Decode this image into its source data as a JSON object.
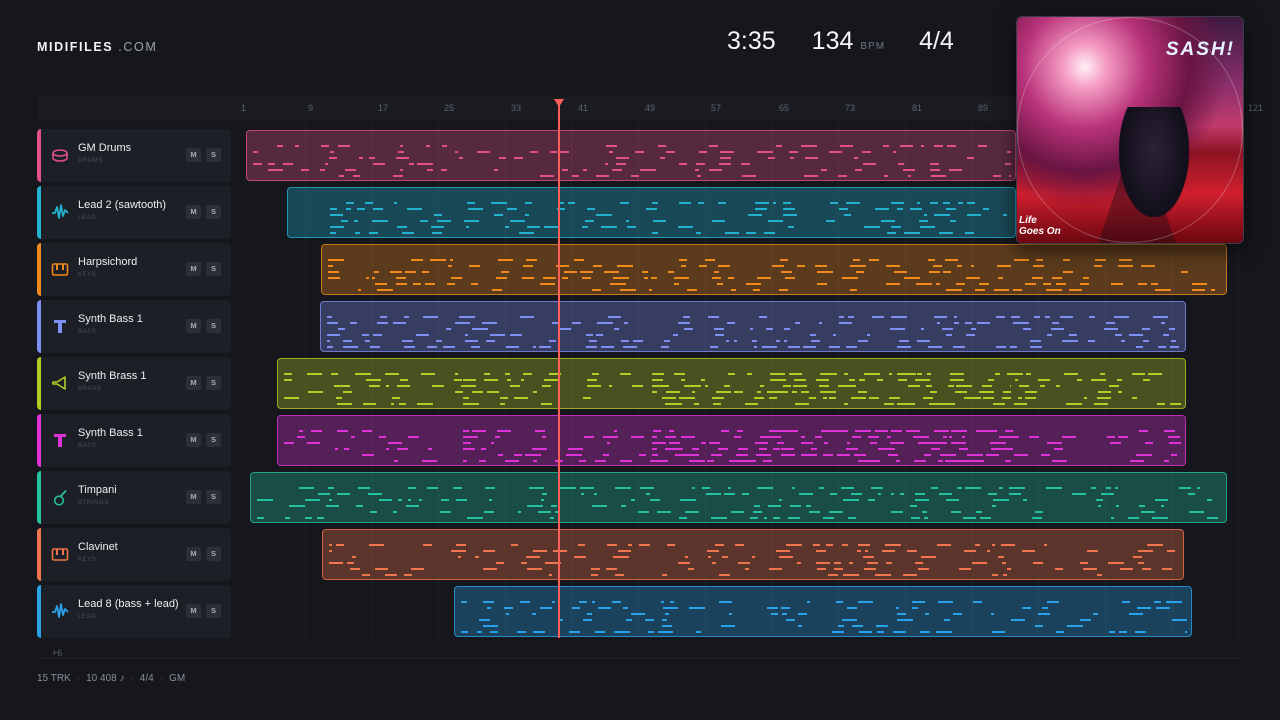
{
  "header": {
    "brand_main": "MIDIFILES",
    "brand_suffix": ".COM",
    "duration": "3:35",
    "tempo": "134",
    "tempo_unit": "BPM",
    "time_signature": "4/4"
  },
  "ruler": {
    "marks": [
      "1",
      "9",
      "17",
      "25",
      "33",
      "41",
      "49",
      "57",
      "65",
      "73",
      "81",
      "89",
      "121"
    ]
  },
  "tracks": [
    {
      "name": "GM Drums",
      "category": "DRUMS",
      "color": "#e2508a",
      "icon": "drum-icon",
      "mute": "M",
      "solo": "S"
    },
    {
      "name": "Lead 2 (sawtooth)",
      "category": "LEAD",
      "color": "#22b2cf",
      "icon": "wave-icon",
      "mute": "M",
      "solo": "S"
    },
    {
      "name": "Harpsichord",
      "category": "KEYS",
      "color": "#f08a1c",
      "icon": "keys-icon",
      "mute": "M",
      "solo": "S"
    },
    {
      "name": "Synth Bass 1",
      "category": "BASS",
      "color": "#7d8ff2",
      "icon": "bass-icon",
      "mute": "M",
      "solo": "S"
    },
    {
      "name": "Synth Brass 1",
      "category": "BRASS",
      "color": "#b4cc24",
      "icon": "horn-icon",
      "mute": "M",
      "solo": "S"
    },
    {
      "name": "Synth Bass 1",
      "category": "BASS",
      "color": "#dd33d8",
      "icon": "bass-icon",
      "mute": "M",
      "solo": "S"
    },
    {
      "name": "Timpani",
      "category": "STRINGS",
      "color": "#25c0a0",
      "icon": "guitar-icon",
      "mute": "M",
      "solo": "S"
    },
    {
      "name": "Clavinet",
      "category": "KEYS",
      "color": "#f0744c",
      "icon": "keys-icon",
      "mute": "M",
      "solo": "S"
    },
    {
      "name": "Lead 8 (bass + lead)",
      "category": "LEAD",
      "color": "#2aa2ea",
      "icon": "wave-icon",
      "mute": "M",
      "solo": "S"
    }
  ],
  "album": {
    "artist": "SASH!",
    "title_line1": "Life",
    "title_line2": "Goes On"
  },
  "more_tracks": "+6",
  "footer": {
    "track_count": "15 TRK",
    "note_count": "10 408 ♪",
    "time_signature": "4/4",
    "standard": "GM"
  }
}
